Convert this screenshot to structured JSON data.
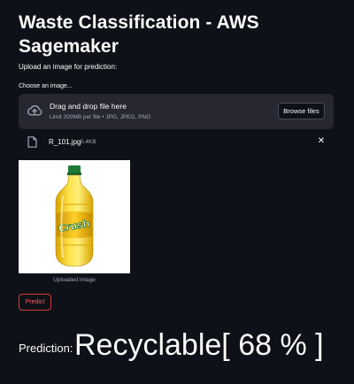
{
  "header": {
    "title": "Waste Classification - AWS Sagemaker"
  },
  "main": {
    "subtitle": "Upload an image for prediction:",
    "uploader": {
      "label": "Choose an image...",
      "drop_title": "Drag and drop file here",
      "drop_limit": "Limit 200MB per file • JPG, JPEG, PNG",
      "browse_label": "Browse files",
      "upload_icon": "cloud-upload-icon"
    },
    "file": {
      "name": "R_101.jpg",
      "size": "5.4KB",
      "icon": "file-icon",
      "remove_glyph": "✕"
    },
    "preview": {
      "caption": "Uploaded Image",
      "label_text": "Crush"
    },
    "predict_label": "Predict",
    "result": {
      "label": "Prediction:",
      "value": "Recyclable[ 68 % ]"
    }
  },
  "colors": {
    "background": "#0e1117",
    "panel": "#262730",
    "accent": "#ff4b4b",
    "text": "#fafafa",
    "muted": "#a3a8b8"
  }
}
